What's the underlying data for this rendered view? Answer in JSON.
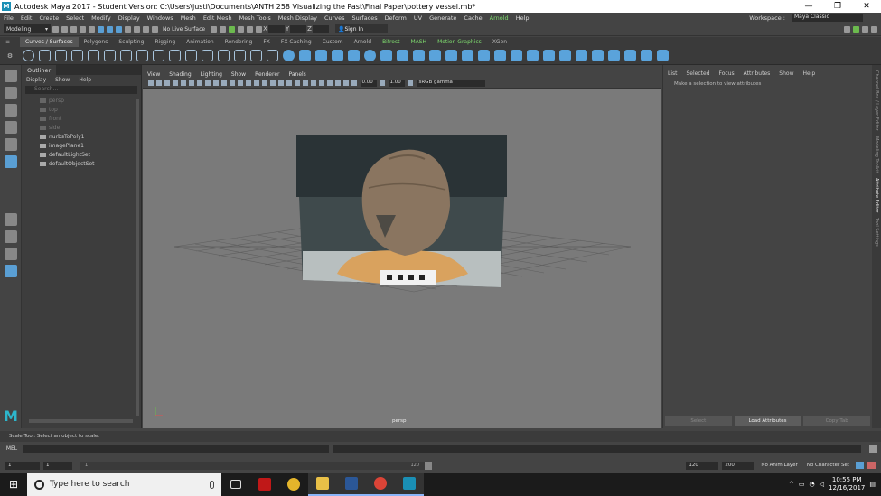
{
  "window": {
    "title": "Autodesk Maya 2017 - Student Version: C:\\Users\\justi\\Documents\\ANTH 258 Visualizing the Past\\Final Paper\\pottery vessel.mb*",
    "icon": "M",
    "controls": [
      "—",
      "❐",
      "✕"
    ]
  },
  "menubar": {
    "items": [
      "File",
      "Edit",
      "Create",
      "Select",
      "Modify",
      "Display",
      "Windows",
      "Mesh",
      "Edit Mesh",
      "Mesh Tools",
      "Mesh Display",
      "Curves",
      "Surfaces",
      "Deform",
      "UV",
      "Generate",
      "Cache",
      "Arnold",
      "Help"
    ],
    "workspace_label": "Workspace :",
    "workspace_value": "Maya Classic"
  },
  "statusline": {
    "mode": "Modeling",
    "live_surface": "No Live Surface",
    "x_label": "X",
    "y_label": "Y",
    "z_label": "Z",
    "sign_in": "Sign In"
  },
  "shelf_tabs": [
    "Curves / Surfaces",
    "Polygons",
    "Sculpting",
    "Rigging",
    "Animation",
    "Rendering",
    "FX",
    "FX Caching",
    "Custom",
    "Arnold",
    "Bifrost",
    "MASH",
    "Motion Graphics",
    "XGen"
  ],
  "outliner": {
    "tab": "Outliner",
    "menu": [
      "Display",
      "Show",
      "Help"
    ],
    "search_placeholder": "Search...",
    "items": [
      {
        "label": "persp",
        "dim": true
      },
      {
        "label": "top",
        "dim": true
      },
      {
        "label": "front",
        "dim": true
      },
      {
        "label": "side",
        "dim": true
      },
      {
        "label": "nurbsToPoly1",
        "dim": false
      },
      {
        "label": "imagePlane1",
        "dim": false
      },
      {
        "label": "defaultLightSet",
        "dim": false
      },
      {
        "label": "defaultObjectSet",
        "dim": false
      }
    ]
  },
  "viewport": {
    "menu": [
      "View",
      "Shading",
      "Lighting",
      "Show",
      "Renderer",
      "Panels"
    ],
    "near_value": "0.00",
    "far_value": "1.00",
    "color_space": "sRGB gamma",
    "camera": "persp"
  },
  "attribute_editor": {
    "menu": [
      "List",
      "Selected",
      "Focus",
      "Attributes",
      "Show",
      "Help"
    ],
    "message": "Make a selection to view attributes",
    "buttons": [
      "Select",
      "Load Attributes",
      "Copy Tab"
    ]
  },
  "side_tabs": [
    "Channel Box / Layer Editor",
    "Modeling Toolkit",
    "Attribute Editor",
    "Tool Settings"
  ],
  "help_line": "Scale Tool: Select an object to scale.",
  "mel_label": "MEL",
  "timeline": {
    "start": "1",
    "current": "1",
    "slider_start": "1",
    "slider_end": "120",
    "range_end": "120",
    "max_end": "200",
    "anim_layer": "No Anim Layer",
    "char_set": "No Character Set"
  },
  "taskbar": {
    "search_placeholder": "Type here to search",
    "time": "10:55 PM",
    "date": "12/16/2017"
  }
}
